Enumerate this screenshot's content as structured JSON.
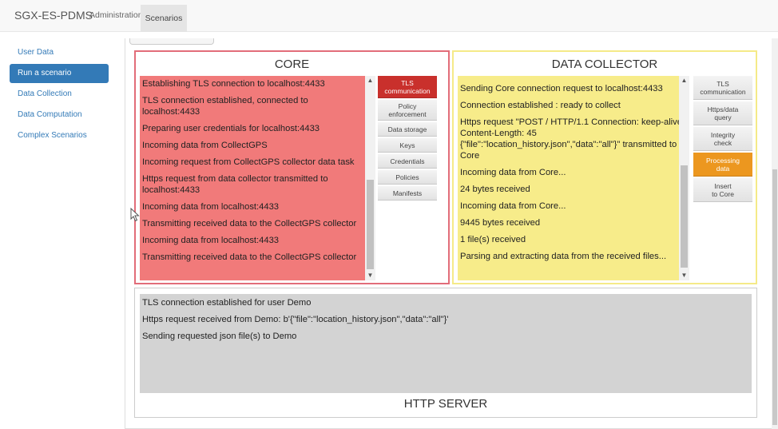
{
  "nav": {
    "brand": "SGX-ES-PDMS",
    "items": [
      {
        "label": "Administration",
        "active": false
      },
      {
        "label": "Scenarios",
        "active": true
      }
    ]
  },
  "sidebar": {
    "items": [
      {
        "label": "User Data",
        "active": false
      },
      {
        "label": "Run a scenario",
        "active": true
      },
      {
        "label": "Data Collection",
        "active": false
      },
      {
        "label": "Data Computation",
        "active": false
      },
      {
        "label": "Complex Scenarios",
        "active": false
      }
    ]
  },
  "core": {
    "title": "CORE",
    "log": [
      "Establishing TLS connection to localhost:4433",
      "TLS connection established, connected to localhost:4433",
      "Preparing user credentials for localhost:4433",
      "Incoming data from CollectGPS",
      "Incoming request from CollectGPS collector data task",
      "Https request from data collector transmitted to localhost:4433",
      "Incoming data from localhost:4433",
      "Transmitting received data to the CollectGPS collector",
      "Incoming data from localhost:4433",
      "Transmitting received data to the CollectGPS collector"
    ],
    "tabs": [
      "TLS\ncommunication",
      "Policy\nenforcement",
      "Data storage",
      "Keys",
      "Credentials",
      "Policies",
      "Manifests"
    ],
    "active_tab": "TLS communication"
  },
  "data_collector": {
    "title": "DATA COLLECTOR",
    "log": [
      "Sending Core connection request to localhost:4433",
      "Connection established : ready to collect",
      "Https request \"POST / HTTP/1.1 Connection: keep-alive Content-Length: 45 {\"file\":\"location_history.json\",\"data\":\"all\"}\" transmitted to Core",
      "Incoming data from Core...",
      "24 bytes received",
      "Incoming data from Core...",
      "9445 bytes received",
      "1 file(s) received",
      "Parsing and extracting data from the received files..."
    ],
    "tabs": [
      "TLS\ncommunication",
      "Https/data\nquery",
      "Integrity\ncheck",
      "Processing\ndata",
      "Insert\nto Core"
    ],
    "active_tab": "Processing data"
  },
  "http_server": {
    "title": "HTTP SERVER",
    "log": [
      "TLS connection established for user Demo",
      "Https request received from Demo: b'{\"file\":\"location_history.json\",\"data\":\"all\"}'",
      "Sending requested json file(s) to Demo"
    ]
  },
  "colors": {
    "core_border": "#e26d79",
    "core_log_bg": "#f17a7a",
    "core_active_tab": "#c9302c",
    "dc_border": "#f5ea88",
    "dc_log_bg": "#f7ec8a",
    "dc_active_tab": "#ec971f",
    "http_log_bg": "#d3d3d3",
    "sidebar_active": "#337ab7"
  },
  "icons": [
    "scroll-up-arrow-icon",
    "scroll-down-arrow-icon",
    "mouse-pointer-icon"
  ]
}
